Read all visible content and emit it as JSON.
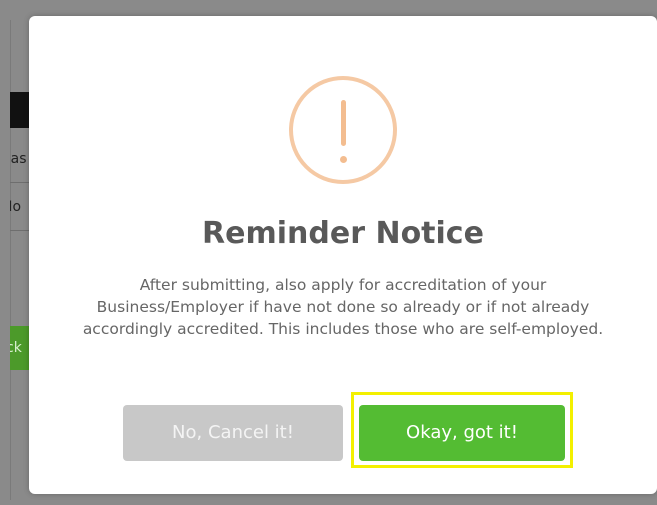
{
  "background": {
    "cell_1_text": "eas",
    "cell_2_text": "No",
    "green_button_text": "ck"
  },
  "dialog": {
    "icon": "warning-exclamation-icon",
    "title": "Reminder Notice",
    "message": "After submitting, also apply for accreditation of your Business/Employer if have not done so already or if not already accordingly accredited. This includes those who are self-employed.",
    "cancel_label": "No, Cancel it!",
    "confirm_label": "Okay, got it!"
  },
  "colors": {
    "warning": "#f3bd90",
    "confirm": "#54bc33",
    "cancel": "#c8c8c8",
    "highlight": "#f3f000"
  }
}
